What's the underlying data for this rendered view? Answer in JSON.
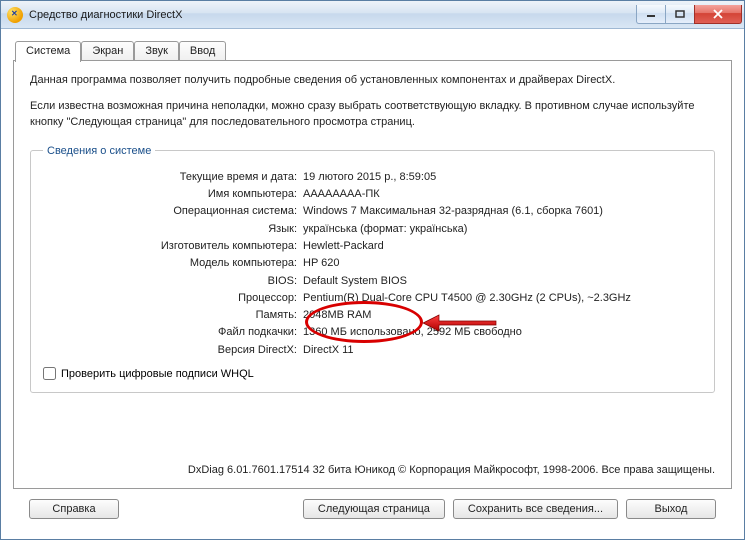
{
  "window": {
    "title": "Средство диагностики DirectX"
  },
  "tabs": {
    "system": "Система",
    "display": "Экран",
    "sound": "Звук",
    "input": "Ввод"
  },
  "intro": {
    "p1": "Данная программа позволяет получить подробные сведения об установленных компонентах и драйверах DirectX.",
    "p2": "Если известна возможная причина неполадки, можно сразу выбрать соответствующую вкладку. В противном случае используйте кнопку \"Следующая страница\" для последовательного просмотра страниц."
  },
  "sysinfo": {
    "legend": "Сведения о системе",
    "rows": [
      {
        "label": "Текущие время и дата:",
        "value": "19 лютого 2015 р., 8:59:05"
      },
      {
        "label": "Имя компьютера:",
        "value": "АААААААА-ПК"
      },
      {
        "label": "Операционная система:",
        "value": "Windows 7 Максимальная 32-разрядная (6.1, сборка 7601)"
      },
      {
        "label": "Язык:",
        "value": "українська (формат: українська)"
      },
      {
        "label": "Изготовитель компьютера:",
        "value": "Hewlett-Packard"
      },
      {
        "label": "Модель компьютера:",
        "value": "HP 620"
      },
      {
        "label": "BIOS:",
        "value": "Default System BIOS"
      },
      {
        "label": "Процессор:",
        "value": "Pentium(R) Dual-Core CPU       T4500  @ 2.30GHz (2 CPUs), ~2.3GHz"
      },
      {
        "label": "Память:",
        "value": "2048MB RAM"
      },
      {
        "label": "Файл подкачки:",
        "value": "1360 МБ использовано, 2592 МБ свободно"
      },
      {
        "label": "Версия DirectX:",
        "value": "DirectX 11"
      }
    ],
    "whql_label": "Проверить цифровые подписи WHQL"
  },
  "footer": "DxDiag 6.01.7601.17514 32 бита Юникод © Корпорация Майкрософт, 1998-2006. Все права защищены.",
  "buttons": {
    "help": "Справка",
    "next": "Следующая страница",
    "save": "Сохранить все сведения...",
    "exit": "Выход"
  }
}
